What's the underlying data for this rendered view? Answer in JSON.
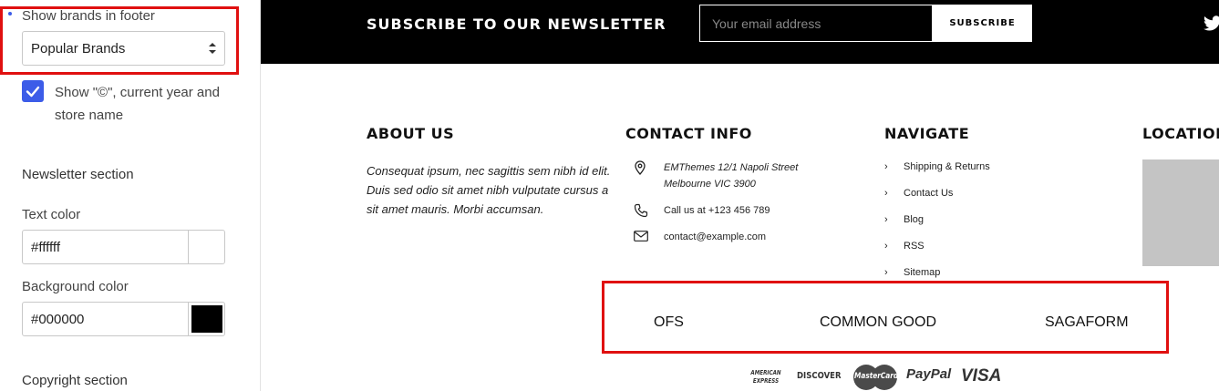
{
  "panel": {
    "brands_label": "Show brands in footer",
    "brands_select_value": "Popular Brands",
    "copyright_checkbox_label": "Show \"©\", current year and store name",
    "newsletter_heading": "Newsletter section",
    "text_color_label": "Text color",
    "text_color_value": "#ffffff",
    "bg_color_label": "Background color",
    "bg_color_value": "#000000",
    "copyright_heading": "Copyright section"
  },
  "colors": {
    "accent": "#3c5ce8",
    "highlight": "#e01010",
    "newsletter_bg": "#000000",
    "newsletter_text": "#ffffff"
  },
  "newsletter": {
    "title": "SUBSCRIBE TO OUR NEWSLETTER",
    "email_placeholder": "Your email address",
    "subscribe_label": "SUBSCRIBE"
  },
  "footer": {
    "about": {
      "title": "ABOUT US",
      "text": "Consequat ipsum, nec sagittis sem nibh id elit. Duis sed odio sit amet nibh vulputate cursus a sit amet mauris. Morbi accumsan."
    },
    "contact": {
      "title": "CONTACT INFO",
      "address_line1": "EMThemes 12/1 Napoli Street",
      "address_line2": "Melbourne VIC 3900",
      "phone": "Call us at +123 456 789",
      "email": "contact@example.com"
    },
    "navigate": {
      "title": "NAVIGATE",
      "items": [
        "Shipping & Returns",
        "Contact Us",
        "Blog",
        "RSS",
        "Sitemap"
      ]
    },
    "location": {
      "title": "LOCATION"
    }
  },
  "brands": [
    "OFS",
    "COMMON GOOD",
    "SAGAFORM"
  ],
  "payments": {
    "amex": "AMERICAN EXPRESS",
    "discover": "DISCOVER",
    "mastercard": "MasterCard",
    "paypal": "PayPal",
    "visa": "VISA"
  }
}
